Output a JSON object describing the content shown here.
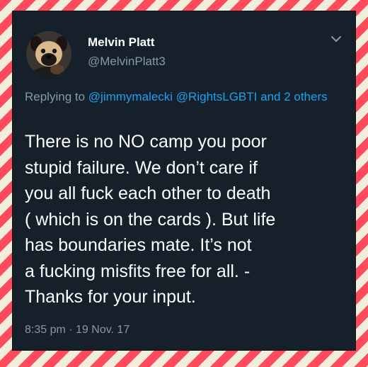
{
  "tweet": {
    "author_name": "Melvin Platt",
    "author_handle": "@MelvinPlatt3",
    "reply_prefix": "Replying to",
    "reply_mentions": [
      "@jimmymalecki",
      "@RightsLGBTI"
    ],
    "reply_and_more": "and 2 others",
    "text": "There is no NO camp you poor\nstupid failure. We don’t care if\nyou all fuck each other to death\n( which is on the cards ). But life\nhas boundaries mate. It’s not\na fucking misfits free for all. -\nThanks for your input.",
    "timestamp": "8:35 pm · 19 Nov. 17"
  },
  "icons": {
    "menu": "chevron-down-icon",
    "avatar": "dog-avatar"
  },
  "colors": {
    "card_background": "#15202b",
    "primary_text": "#ffffff",
    "secondary_text": "#8899a6",
    "link": "#1da1f2",
    "frame_stripe_red": "#ff4a5b",
    "frame_stripe_cream": "#f3eddc"
  }
}
